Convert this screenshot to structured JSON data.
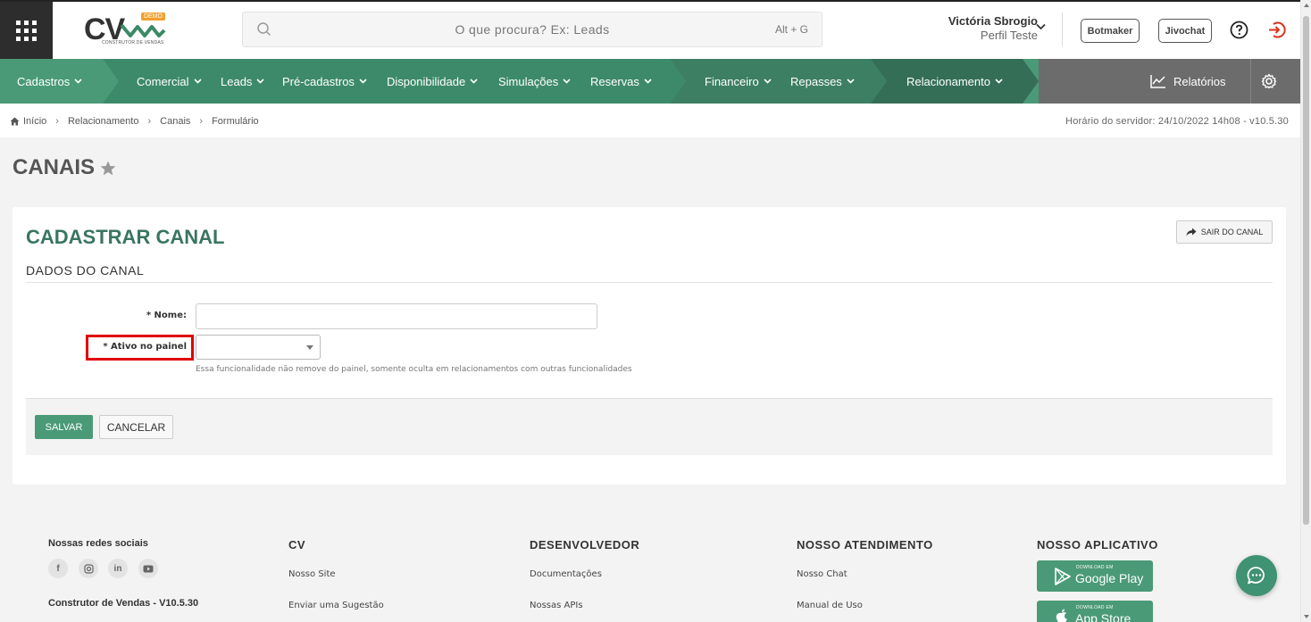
{
  "header": {
    "logo_text": "CV",
    "logo_badge": "DEMO",
    "logo_subtitle": "CONSTRUTOR DE VENDAS",
    "search_placeholder": "O que procura? Ex: Leads",
    "search_shortcut": "Alt + G",
    "user_name": "Victória Sbrogio",
    "user_profile": "Perfil Teste",
    "botmaker_label": "Botmaker",
    "jivochat_label": "Jivochat"
  },
  "nav": {
    "items": [
      {
        "label": "Cadastros"
      },
      {
        "label": "Comercial"
      },
      {
        "label": "Leads"
      },
      {
        "label": "Pré-cadastros"
      },
      {
        "label": "Disponibilidade"
      },
      {
        "label": "Simulações"
      },
      {
        "label": "Reservas"
      },
      {
        "label": "Financeiro"
      },
      {
        "label": "Repasses"
      },
      {
        "label": "Relacionamento"
      }
    ],
    "reports_label": "Relatórios",
    "colors": {
      "primary": "#4a9a77",
      "dark": "#3d7f63",
      "darker": "#346e56",
      "gray": "#6c6c6c"
    }
  },
  "breadcrumb": {
    "items": [
      "Início",
      "Relacionamento",
      "Canais",
      "Formulário"
    ],
    "server_time": "Horário do servidor: 24/10/2022 14h08 - v10.5.30"
  },
  "page": {
    "title": "CANAIS"
  },
  "form": {
    "title": "CADASTRAR CANAL",
    "exit_label": "SAIR DO CANAL",
    "section": "DADOS DO CANAL",
    "nome_label": "* Nome:",
    "nome_value": "",
    "ativo_label": "* Ativo no painel",
    "ativo_value": "",
    "help_text": "Essa funcionalidade não remove do painel, somente oculta em relacionamentos com outras funcionalidades",
    "save_label": "SALVAR",
    "cancel_label": "CANCELAR"
  },
  "footer": {
    "social_title": "Nossas redes sociais",
    "version": "Construtor de Vendas - V10.5.30",
    "cv_title": "CV",
    "cv_links": [
      "Nosso Site",
      "Enviar uma Sugestão"
    ],
    "dev_title": "DESENVOLVEDOR",
    "dev_links": [
      "Documentações",
      "Nossas APIs"
    ],
    "support_title": "NOSSO ATENDIMENTO",
    "support_links": [
      "Nosso Chat",
      "Manual de Uso"
    ],
    "app_title": "NOSSO APLICATIVO",
    "google_small": "DOWNLOAD EM",
    "google_big": "Google Play",
    "apple_small": "DOWNLOAD EM",
    "apple_big": "App Store"
  }
}
